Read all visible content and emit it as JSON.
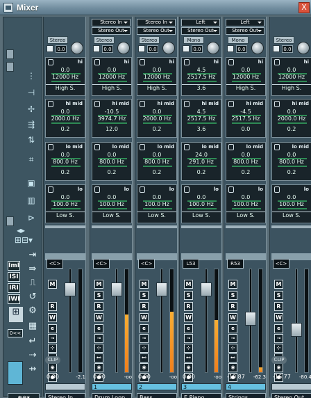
{
  "window": {
    "title": "Mixer",
    "close_label": "X"
  },
  "common": {
    "side_buttons": [
      "ImI",
      "ISI",
      "IRI",
      "IWI"
    ],
    "clip_label": "CLIP",
    "clear_label": "0<<"
  },
  "strips": [
    {
      "routing_in": "",
      "routing_out": "",
      "preset": "Stereo",
      "gain": "0.0",
      "bands": [
        [
          "0.0",
          "12000 Hz",
          "High S."
        ],
        [
          "0.0",
          "2000.0 Hz",
          "0.2"
        ],
        [
          "0.0",
          "800.0 Hz",
          "0.2"
        ],
        [
          "0.0",
          "100.0 Hz",
          "Low S."
        ]
      ],
      "pan": "<C>",
      "buttons": [
        "M",
        "",
        "R",
        "W"
      ],
      "clip": "CLIP",
      "volume": "0.00",
      "peak": "-2.1",
      "number": "",
      "name": "Stereo In",
      "meter": 0.0
    },
    {
      "routing_in": "Stereo In",
      "routing_out": "Stereo Out",
      "preset": "Stereo",
      "gain": "0.0",
      "bands": [
        [
          "0.0",
          "12000 Hz",
          "High S."
        ],
        [
          "-10.5",
          "3974.7 Hz",
          "12.0"
        ],
        [
          "0.0",
          "800.0 Hz",
          "0.2"
        ],
        [
          "0.0",
          "100.0 Hz",
          "Low S."
        ]
      ],
      "pan": "<C>",
      "buttons": [
        "M",
        "S",
        "R",
        "W"
      ],
      "clip": "",
      "volume": "0.00",
      "peak": "-oo",
      "number": "1",
      "name": "Drum Loop",
      "meter": 0.56
    },
    {
      "routing_in": "Stereo In",
      "routing_out": "Stereo Out",
      "preset": "Stereo",
      "gain": "0.0",
      "bands": [
        [
          "0.0",
          "12000 Hz",
          "High S."
        ],
        [
          "0.0",
          "2000.0 Hz",
          "0.2"
        ],
        [
          "0.0",
          "800.0 Hz",
          "0.2"
        ],
        [
          "0.0",
          "100.0 Hz",
          "Low S."
        ]
      ],
      "pan": "<C>",
      "buttons": [
        "M",
        "S",
        "R",
        "W"
      ],
      "clip": "",
      "volume": "0.00",
      "peak": "-oo",
      "number": "2",
      "name": "Bass",
      "meter": 0.59
    },
    {
      "routing_in": "Left",
      "routing_out": "Stereo Out",
      "preset": "Mono",
      "gain": "0.0",
      "bands": [
        [
          "4.5",
          "2517.5 Hz",
          "3.6"
        ],
        [
          "4.5",
          "2517.5 Hz",
          "3.6"
        ],
        [
          "24.0",
          "291.0 Hz",
          "0.2"
        ],
        [
          "0.0",
          "100.0 Hz",
          "Low S."
        ]
      ],
      "pan": "L53",
      "buttons": [
        "M",
        "S",
        "R",
        "W"
      ],
      "clip": "",
      "volume": "0.00",
      "peak": "-oo",
      "number": "3",
      "name": "E.Piano",
      "meter": 0.51
    },
    {
      "routing_in": "Left",
      "routing_out": "Stereo Out",
      "preset": "Mono",
      "gain": "0.0",
      "bands": [
        [
          "0.0",
          "12000 Hz",
          "High S."
        ],
        [
          "-4.5",
          "2517.5 Hz",
          "0.0"
        ],
        [
          "0.0",
          "800.0 Hz",
          "0.2"
        ],
        [
          "0.0",
          "100.0 Hz",
          "Low S."
        ]
      ],
      "pan": "R53",
      "buttons": [
        "M",
        "S",
        "R",
        "W"
      ],
      "clip": "",
      "volume": "-10.87",
      "peak": "-62.3",
      "number": "4",
      "name": "Strings",
      "meter": 0.05
    },
    {
      "routing_in": "",
      "routing_out": "",
      "preset": "Stereo",
      "gain": "0.0",
      "bands": [
        [
          "0.0",
          "12000 Hz",
          "High S."
        ],
        [
          "0.0",
          "2000.0 Hz",
          "0.2"
        ],
        [
          "0.0",
          "800.0 Hz",
          "0.2"
        ],
        [
          "0.0",
          "100.0 Hz",
          "Low S."
        ]
      ],
      "pan": "<C>",
      "buttons": [
        "M",
        "S",
        "R",
        "W"
      ],
      "clip": "CLIP",
      "volume": "-16.77",
      "peak": "-80.4",
      "number": "",
      "name": "Stereo Out",
      "meter": 0.0
    }
  ],
  "band_names": [
    "hi",
    "hi mid",
    "lo mid",
    "lo"
  ],
  "colors": {
    "accent": "#66c0e0",
    "meter": "#f08a22",
    "panel": "#3c5360"
  }
}
